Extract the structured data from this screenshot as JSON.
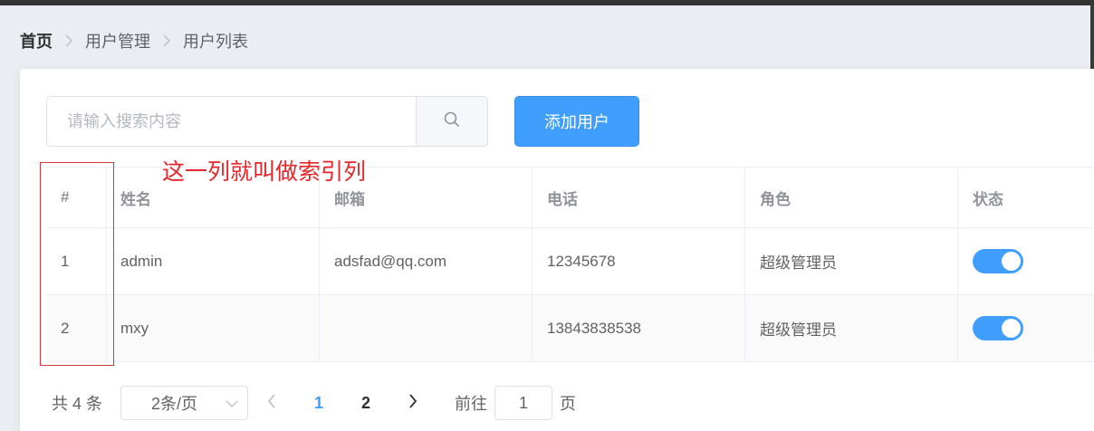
{
  "breadcrumb": {
    "items": [
      "首页",
      "用户管理",
      "用户列表"
    ]
  },
  "search": {
    "placeholder": "请输入搜索内容",
    "value": ""
  },
  "toolbar": {
    "add_label": "添加用户"
  },
  "annotation": {
    "text": "这一列就叫做索引列",
    "color": "#e8252a"
  },
  "table": {
    "columns": [
      "#",
      "姓名",
      "邮箱",
      "电话",
      "角色",
      "状态"
    ],
    "rows": [
      {
        "index": "1",
        "name": "admin",
        "email": "adsfad@qq.com",
        "phone": "12345678",
        "role": "超级管理员",
        "status": true
      },
      {
        "index": "2",
        "name": "mxy",
        "email": "",
        "phone": "13843838538",
        "role": "超级管理员",
        "status": true
      }
    ]
  },
  "pagination": {
    "total_text": "共 4 条",
    "page_size_label": "2条/页",
    "pages": [
      "1",
      "2"
    ],
    "current_page": "1",
    "goto_label": "前往",
    "goto_value": "1",
    "page_suffix": "页"
  },
  "colors": {
    "primary": "#409eff",
    "switch_on": "#409eff"
  },
  "icons": [
    "chevron-right-icon",
    "search-icon",
    "chevron-down-icon",
    "chevron-left-icon"
  ]
}
